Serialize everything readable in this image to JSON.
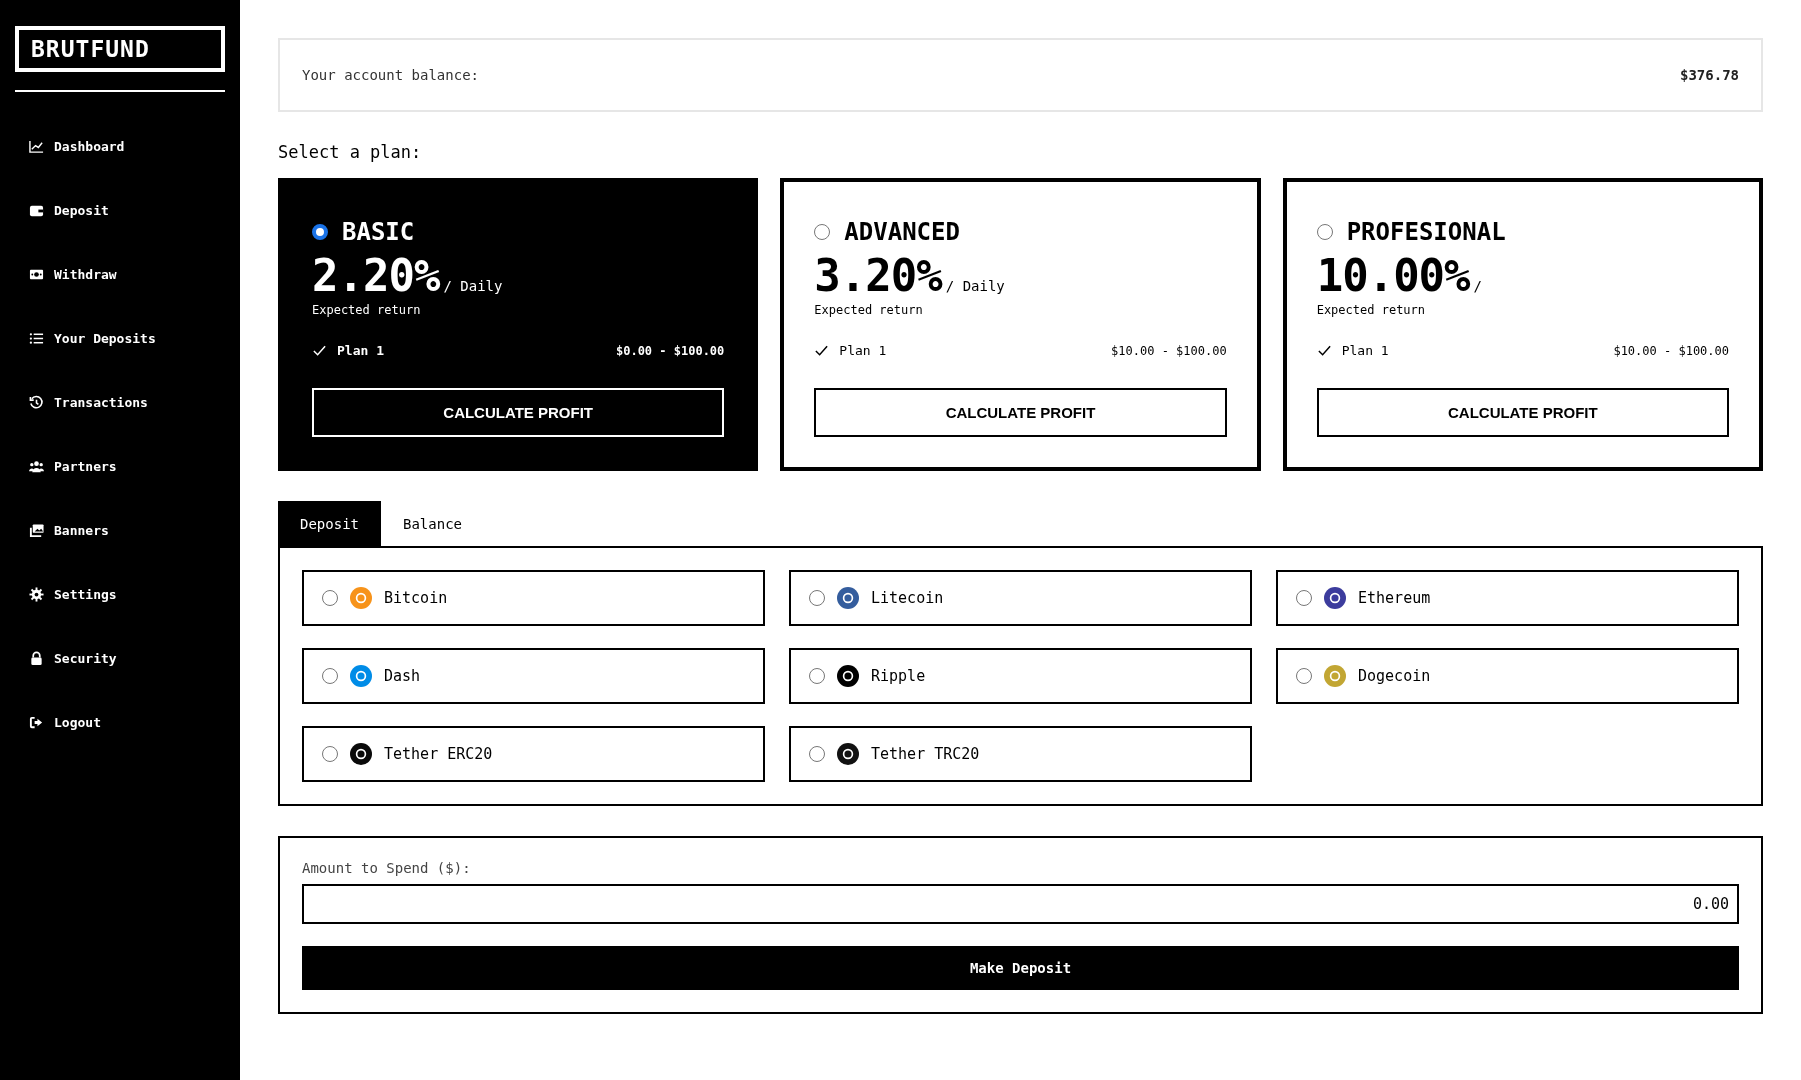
{
  "sidebar": {
    "logo": "BRUTFUND",
    "items": [
      {
        "label": "Dashboard"
      },
      {
        "label": "Deposit"
      },
      {
        "label": "Withdraw"
      },
      {
        "label": "Your Deposits"
      },
      {
        "label": "Transactions"
      },
      {
        "label": "Partners"
      },
      {
        "label": "Banners"
      },
      {
        "label": "Settings"
      },
      {
        "label": "Security"
      },
      {
        "label": "Logout"
      }
    ]
  },
  "balance": {
    "label": "Your account balance:",
    "value": "$376.78"
  },
  "plans_heading": "Select a plan:",
  "plans": [
    {
      "name": "BASIC",
      "selected": true,
      "rate": "2.20%",
      "period": "/ Daily",
      "caption": "Expected return",
      "feature": "Plan 1",
      "range": "$0.00 - $100.00",
      "button": "CALCULATE PROFIT"
    },
    {
      "name": "ADVANCED",
      "selected": false,
      "rate": "3.20%",
      "period": "/ Daily",
      "caption": "Expected return",
      "feature": "Plan 1",
      "range": "$10.00 - $100.00",
      "button": "CALCULATE PROFIT"
    },
    {
      "name": "PROFESIONAL",
      "selected": false,
      "rate": "10.00%",
      "period": "/",
      "caption": "Expected return",
      "feature": "Plan 1",
      "range": "$10.00 - $100.00",
      "button": "CALCULATE PROFIT"
    }
  ],
  "tabs": [
    {
      "label": "Deposit",
      "selected": true
    },
    {
      "label": "Balance",
      "selected": false
    }
  ],
  "currencies": [
    {
      "name": "Bitcoin",
      "selected": false,
      "color": "#f7931a"
    },
    {
      "name": "Litecoin",
      "selected": false,
      "color": "#345d9d"
    },
    {
      "name": "Ethereum",
      "selected": false,
      "color": "#3c3c9d"
    },
    {
      "name": "Dash",
      "selected": false,
      "color": "#008ce7"
    },
    {
      "name": "Ripple",
      "selected": false,
      "color": "#000000"
    },
    {
      "name": "Dogecoin",
      "selected": false,
      "color": "#c2a633"
    },
    {
      "name": "Tether ERC20",
      "selected": false,
      "color": "#0a0a0a"
    },
    {
      "name": "Tether TRC20",
      "selected": false,
      "color": "#111111"
    }
  ],
  "amount": {
    "label": "Amount to Spend ($):",
    "value": "0.00",
    "button": "Make Deposit"
  }
}
